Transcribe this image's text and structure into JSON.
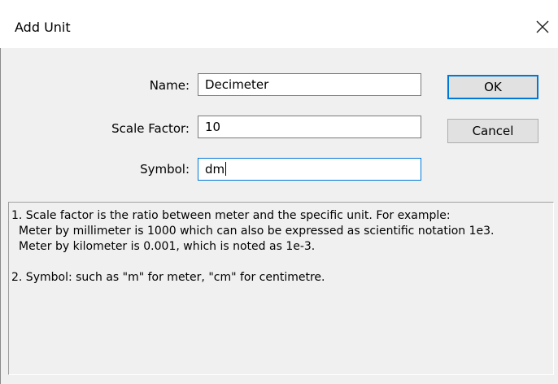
{
  "dialog": {
    "title": "Add Unit",
    "close_icon": "close-icon"
  },
  "form": {
    "name_label": "Name:",
    "name_value": "Decimeter",
    "scale_label": "Scale Factor:",
    "scale_value": "10",
    "symbol_label": "Symbol:",
    "symbol_value": "dm"
  },
  "buttons": {
    "ok_label": "OK",
    "cancel_label": "Cancel"
  },
  "info": {
    "line1": "1. Scale factor is the ratio between meter and the specific unit. For example:",
    "line2": "Meter by millimeter is 1000 which can also be expressed as scientific notation 1e3.",
    "line3": "Meter by kilometer is 0.001, which is noted as 1e-3.",
    "line4": "2. Symbol: such as \"m\" for meter, \"cm\" for centimetre."
  },
  "colors": {
    "focus_border": "#0078d7",
    "dialog_bg": "#f0f0f0"
  }
}
